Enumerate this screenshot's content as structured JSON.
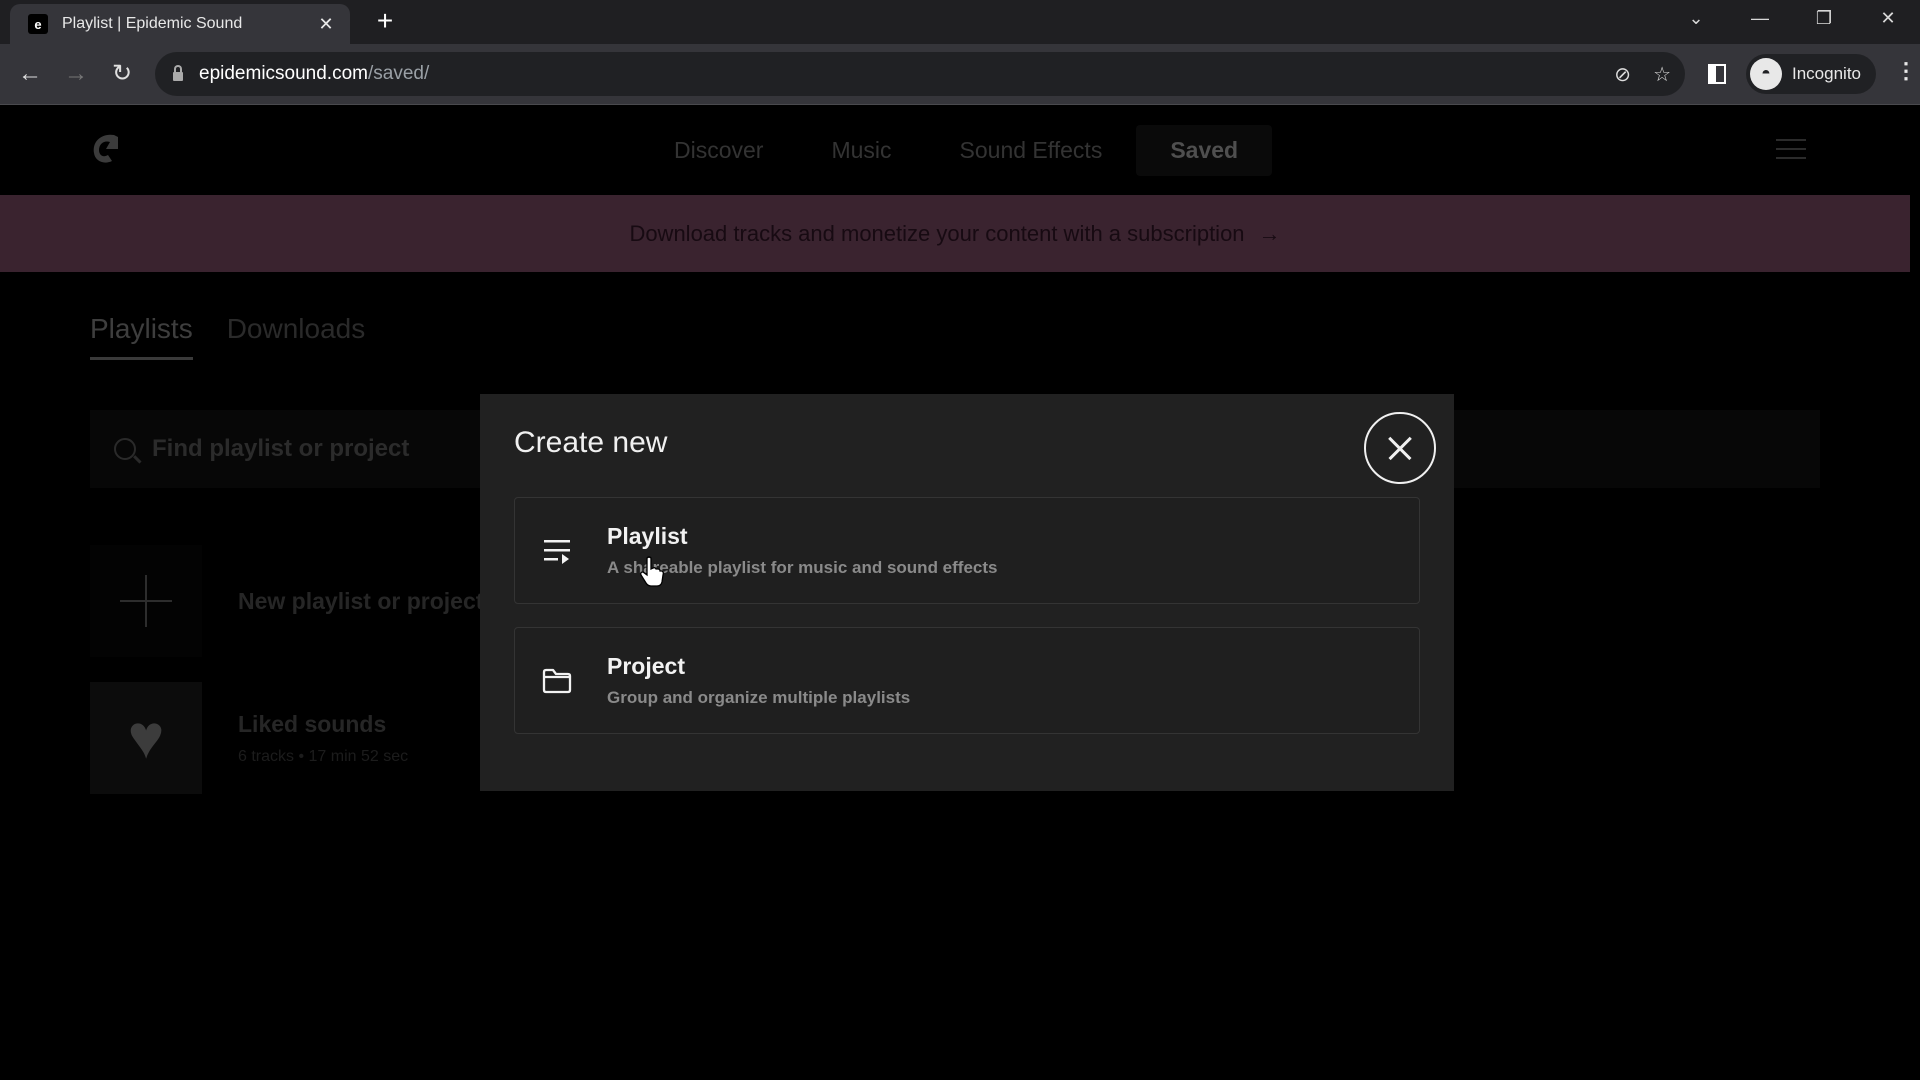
{
  "browser": {
    "tab_title": "Playlist | Epidemic Sound",
    "tab_favicon": "e",
    "new_tab_label": "+",
    "url_host": "epidemicsound.com",
    "url_path": "/saved/",
    "profile_label": "Incognito",
    "window_controls": {
      "tab_search": "⌄",
      "minimize": "—",
      "restore": "❐",
      "close": "✕"
    }
  },
  "site": {
    "nav": [
      "Discover",
      "Music",
      "Sound Effects",
      "Saved"
    ],
    "active_nav": "Saved",
    "banner_text": "Download tracks and monetize your content with a subscription",
    "banner_arrow": "→",
    "colors": {
      "banner_bg": "#3a232f",
      "modal_bg": "#212121",
      "page_bg": "#000000"
    }
  },
  "saved": {
    "tabs": [
      "Playlists",
      "Downloads"
    ],
    "active_tab": "Playlists",
    "search_placeholder": "Find playlist or project",
    "items": [
      {
        "title": "New playlist or project",
        "subtitle": "",
        "icon": "plus-icon"
      },
      {
        "title": "Liked sounds",
        "subtitle": "6 tracks • 17 min 52 sec",
        "icon": "heart-icon"
      }
    ]
  },
  "modal": {
    "title": "Create new",
    "close_icon": "close-icon",
    "options": [
      {
        "title": "Playlist",
        "description": "A shareable playlist for music and sound effects",
        "icon": "playlist-icon"
      },
      {
        "title": "Project",
        "description": "Group and organize multiple playlists",
        "icon": "folder-icon"
      }
    ]
  }
}
